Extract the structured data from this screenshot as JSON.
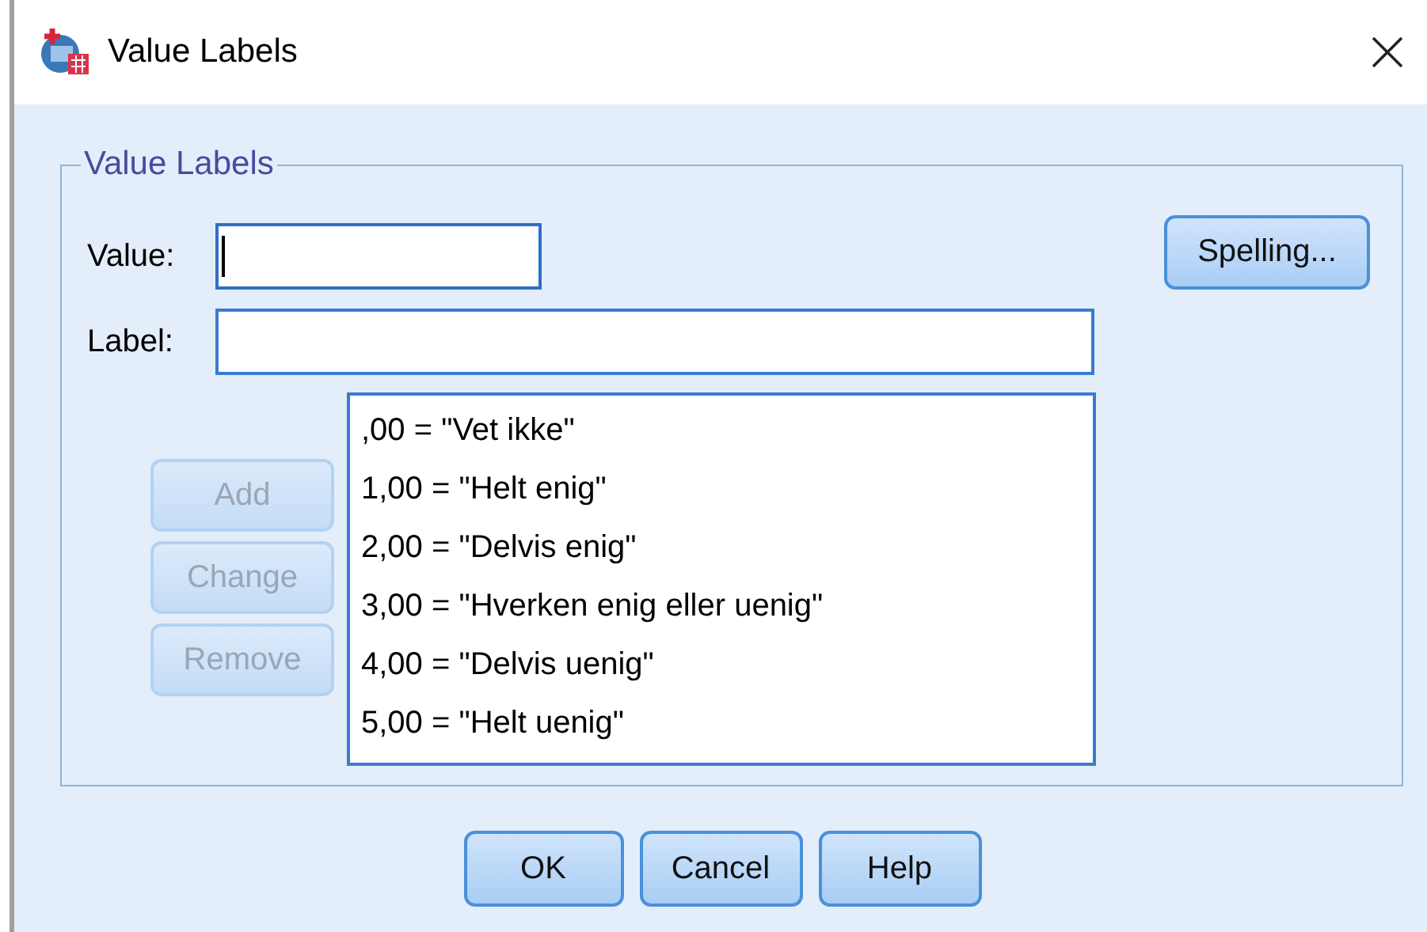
{
  "window": {
    "title": "Value Labels"
  },
  "group": {
    "legend": "Value Labels"
  },
  "fields": [
    {
      "label": "Value:",
      "focused": true,
      "kind": "short"
    },
    {
      "label": "Label:",
      "focused": false,
      "kind": "long"
    }
  ],
  "spelling_button": {
    "label": "Spelling...",
    "disabled": false
  },
  "side_buttons": [
    {
      "label": "Add",
      "disabled": true
    },
    {
      "label": "Change",
      "disabled": true
    },
    {
      "label": "Remove",
      "disabled": true
    }
  ],
  "labels_list": [
    ",00 = \"Vet ikke\"",
    "1,00 = \"Helt enig\"",
    "2,00 = \"Delvis enig\"",
    "3,00 = \"Hverken enig eller uenig\"",
    "4,00 = \"Delvis uenig\"",
    "5,00 = \"Helt uenig\""
  ],
  "buttons": [
    {
      "label": "OK",
      "disabled": false
    },
    {
      "label": "Cancel",
      "disabled": false
    },
    {
      "label": "Help",
      "disabled": false
    }
  ]
}
